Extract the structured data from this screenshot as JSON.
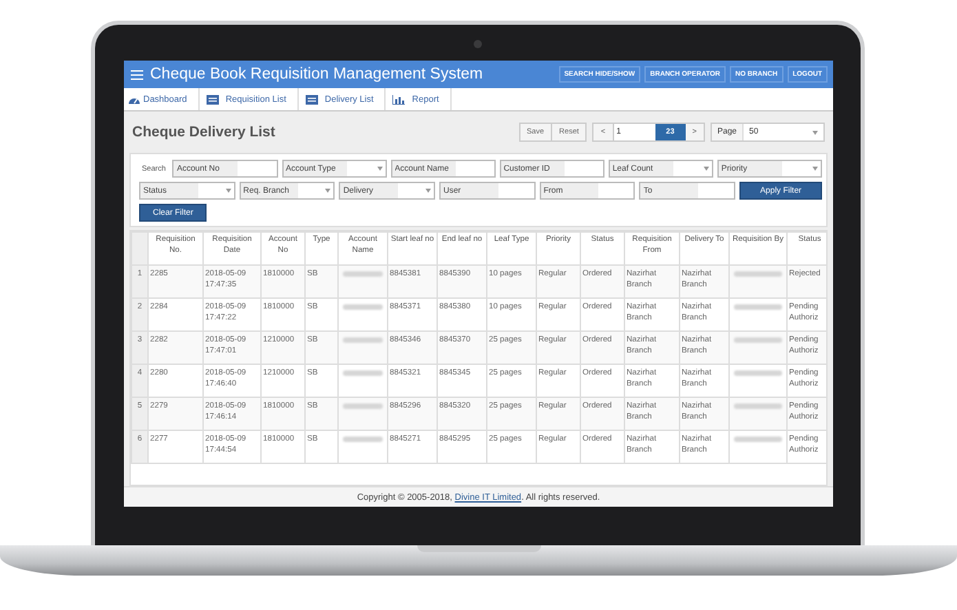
{
  "app": {
    "title": "Cheque Book Requisition Management System",
    "header_buttons": [
      "SEARCH HIDE/SHOW",
      "BRANCH OPERATOR",
      "NO BRANCH",
      "LOGOUT"
    ],
    "nav": [
      {
        "label": "Dashboard",
        "kind": "gauge"
      },
      {
        "label": "Requisition List",
        "kind": "list"
      },
      {
        "label": "Delivery List",
        "kind": "list"
      },
      {
        "label": "Report",
        "kind": "chart"
      }
    ],
    "page_title": "Cheque Delivery List",
    "toolbar": {
      "save": "Save",
      "reset": "Reset",
      "prev": "<",
      "page": "1",
      "total": "23",
      "next": ">",
      "page_label": "Page",
      "page_size": "50"
    },
    "filters": {
      "search_label": "Search",
      "top_fields": [
        {
          "kind": "text",
          "placeholder": "Account No"
        },
        {
          "kind": "select",
          "label": "Account Type"
        },
        {
          "kind": "text",
          "placeholder": "Account Name"
        },
        {
          "kind": "text",
          "placeholder": "Customer ID"
        },
        {
          "kind": "select",
          "label": "Leaf Count"
        },
        {
          "kind": "select",
          "label": "Priority"
        }
      ],
      "bottom_fields": [
        {
          "kind": "select",
          "label": "Status"
        },
        {
          "kind": "select",
          "label": "Req. Branch"
        },
        {
          "kind": "select",
          "label": "Delivery"
        },
        {
          "kind": "text",
          "placeholder": "User"
        },
        {
          "kind": "text",
          "placeholder": "From"
        },
        {
          "kind": "text",
          "placeholder": "To"
        }
      ],
      "apply": "Apply Filter",
      "clear": "Clear Filter"
    },
    "table": {
      "columns": [
        null,
        "Requisition No.",
        "Requisition Date",
        "Account No",
        "Type",
        "Account Name",
        "Start leaf no",
        "End leaf no",
        "Leaf Type",
        "Priority",
        "Status",
        "Requisition From",
        "Delivery To",
        "Requisition By",
        "Status"
      ],
      "rows": [
        [
          "1",
          "2285",
          "2018-05-09 17:47:35",
          "1810000",
          "SB",
          null,
          "8845381",
          "8845390",
          "10 pages",
          "Regular",
          "Ordered",
          "Nazirhat Branch",
          "Nazirhat Branch",
          null,
          "Rejected"
        ],
        [
          "2",
          "2284",
          "2018-05-09 17:47:22",
          "1810000",
          "SB",
          null,
          "8845371",
          "8845380",
          "10 pages",
          "Regular",
          "Ordered",
          "Nazirhat Branch",
          "Nazirhat Branch",
          null,
          "Pending Authoriz"
        ],
        [
          "3",
          "2282",
          "2018-05-09 17:47:01",
          "1210000",
          "SB",
          null,
          "8845346",
          "8845370",
          "25 pages",
          "Regular",
          "Ordered",
          "Nazirhat Branch",
          "Nazirhat Branch",
          null,
          "Pending Authoriz"
        ],
        [
          "4",
          "2280",
          "2018-05-09 17:46:40",
          "1210000",
          "SB",
          null,
          "8845321",
          "8845345",
          "25 pages",
          "Regular",
          "Ordered",
          "Nazirhat Branch",
          "Nazirhat Branch",
          null,
          "Pending Authoriz"
        ],
        [
          "5",
          "2279",
          "2018-05-09 17:46:14",
          "1810000",
          "SB",
          null,
          "8845296",
          "8845320",
          "25 pages",
          "Regular",
          "Ordered",
          "Nazirhat Branch",
          "Nazirhat Branch",
          null,
          "Pending Authoriz"
        ],
        [
          "6",
          "2277",
          "2018-05-09 17:44:54",
          "1810000",
          "SB",
          null,
          "8845271",
          "8845295",
          "25 pages",
          "Regular",
          "Ordered",
          "Nazirhat Branch",
          "Nazirhat Branch",
          null,
          "Pending Authoriz"
        ]
      ]
    },
    "footer": {
      "before": "Copyright © 2005-2018,",
      "link": "Divine IT Limited",
      "after": ". All rights reserved."
    }
  }
}
